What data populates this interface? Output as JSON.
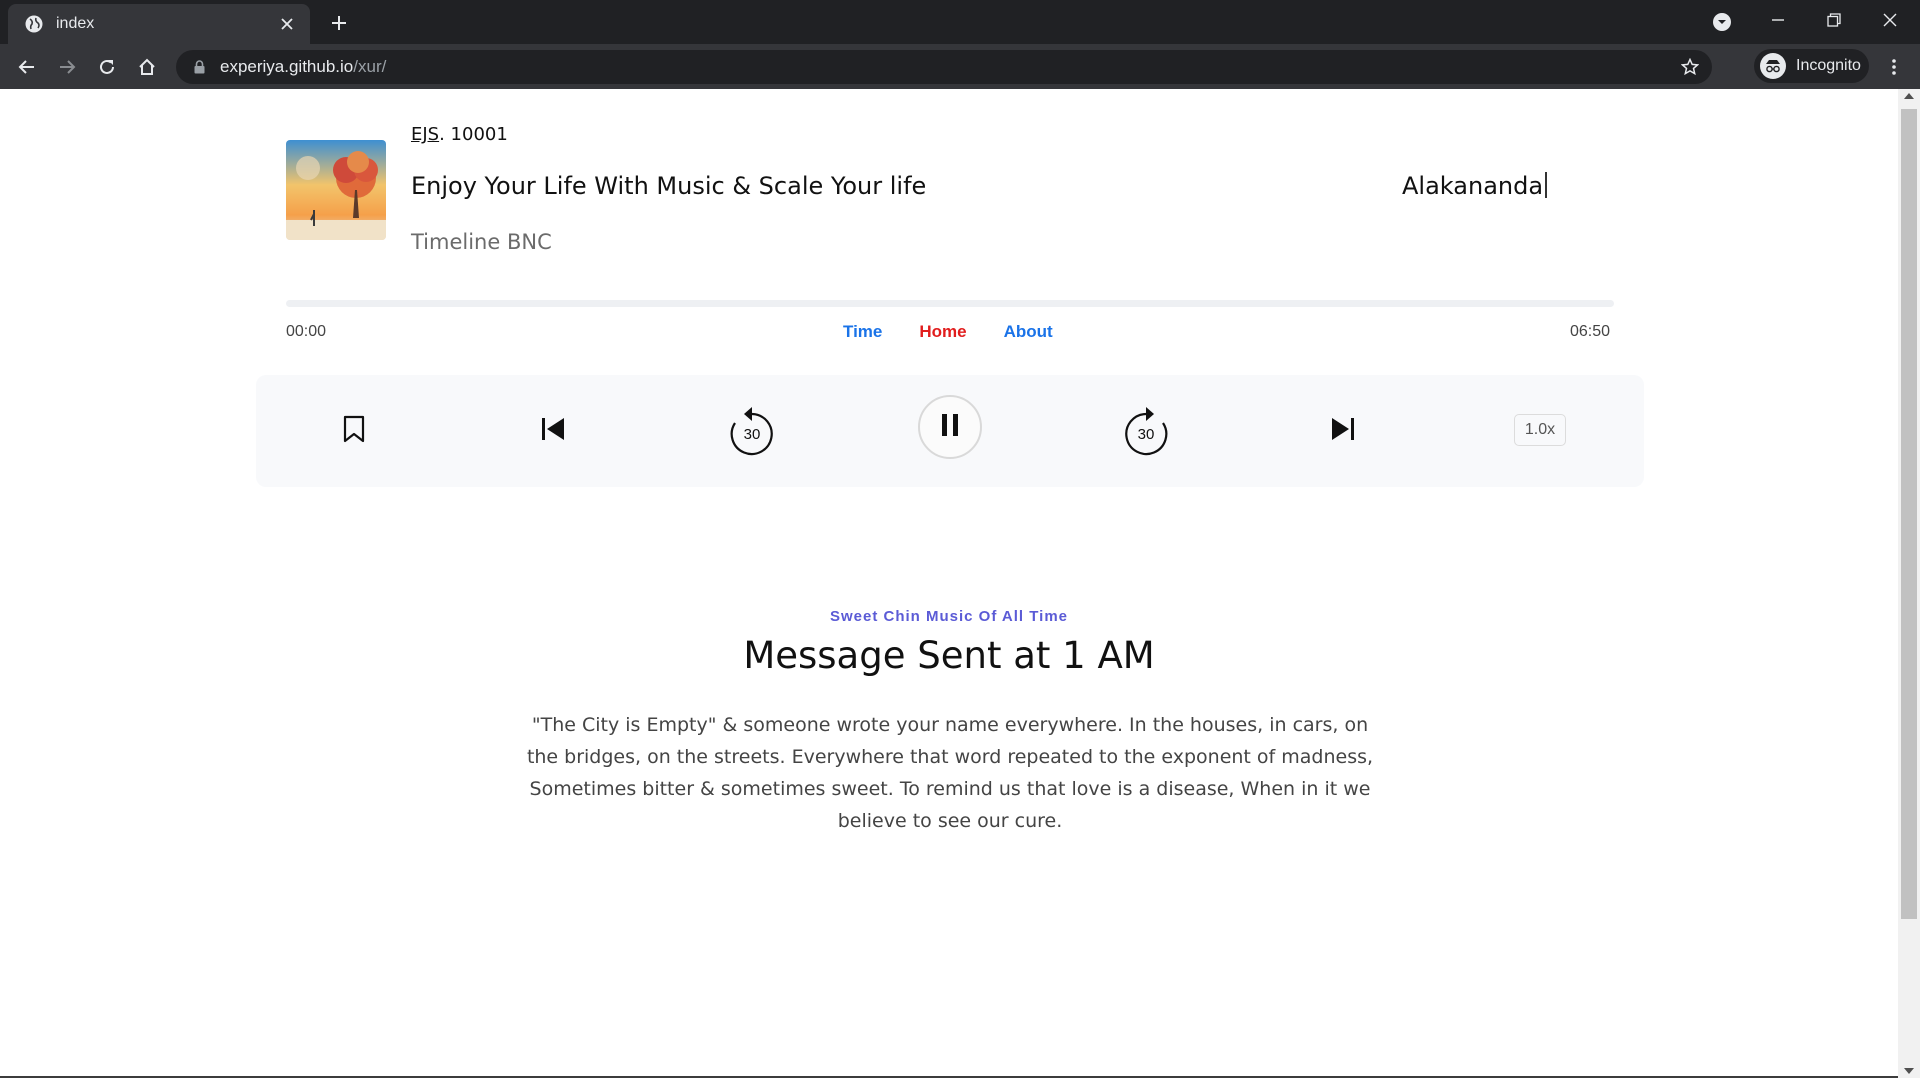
{
  "browser": {
    "tab_title": "index",
    "url_domain": "experiya.github.io",
    "url_path": "/xur/",
    "profile_label": "Incognito"
  },
  "player": {
    "meta_link": "EJS",
    "meta_rest": ". 10001",
    "track_title": "Enjoy Your Life With Music & Scale Your life",
    "subtitle": "Timeline BNC",
    "artist": "Alakananda",
    "time_start": "00:00",
    "time_end": "06:50",
    "progress": 0,
    "nav": {
      "time": "Time",
      "home": "Home",
      "about": "About"
    },
    "nav_colors": {
      "time": "#1a73e8",
      "home": "#e11d1d",
      "about": "#1a73e8"
    },
    "skip_back_label": "30",
    "skip_forward_label": "30",
    "speed_label": "1.0x"
  },
  "article": {
    "kicker": "Sweet Chin Music Of All Time",
    "headline": "Message Sent at 1 AM",
    "body": "\"The City is Empty\" & someone wrote your name everywhere. In the houses, in cars, on the bridges, on the streets. Everywhere that word repeated to the exponent of madness, Sometimes bitter & sometimes sweet. To remind us that love is a disease, When in it we believe to see our cure."
  }
}
